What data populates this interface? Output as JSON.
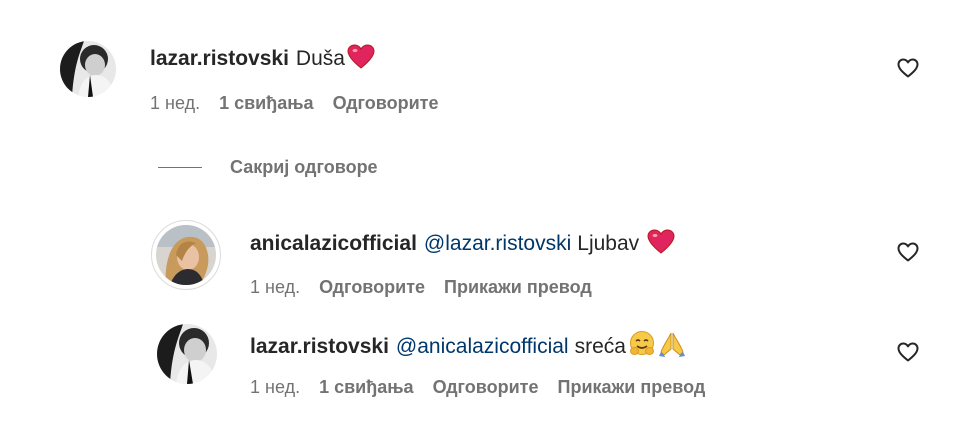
{
  "comments": [
    {
      "username": "lazar.ristovski",
      "mention": "",
      "text": "Duša",
      "time": "1 нед.",
      "likes": "1 свиђања",
      "reply": "Одговорите",
      "translate": ""
    },
    {
      "username": "anicalazicofficial",
      "mention": "@lazar.ristovski",
      "text": "Ljubav",
      "time": "1 нед.",
      "likes": "",
      "reply": "Одговорите",
      "translate": "Прикажи превод"
    },
    {
      "username": "lazar.ristovski",
      "mention": "@anicalazicofficial",
      "text": "sreća",
      "time": "1 нед.",
      "likes": "1 свиђања",
      "reply": "Одговорите",
      "translate": "Прикажи превод"
    }
  ],
  "hide_replies_label": "Сакриј одговоре",
  "colors": {
    "text": "#262626",
    "secondary": "#737373",
    "mention": "#00376b",
    "heart_emoji": "#e0245e"
  },
  "icons": {
    "like": "heart-outline-icon",
    "emoji_heart": "red-heart-emoji",
    "emoji_hug": "hugging-face-emoji",
    "emoji_pray": "folded-hands-emoji"
  }
}
